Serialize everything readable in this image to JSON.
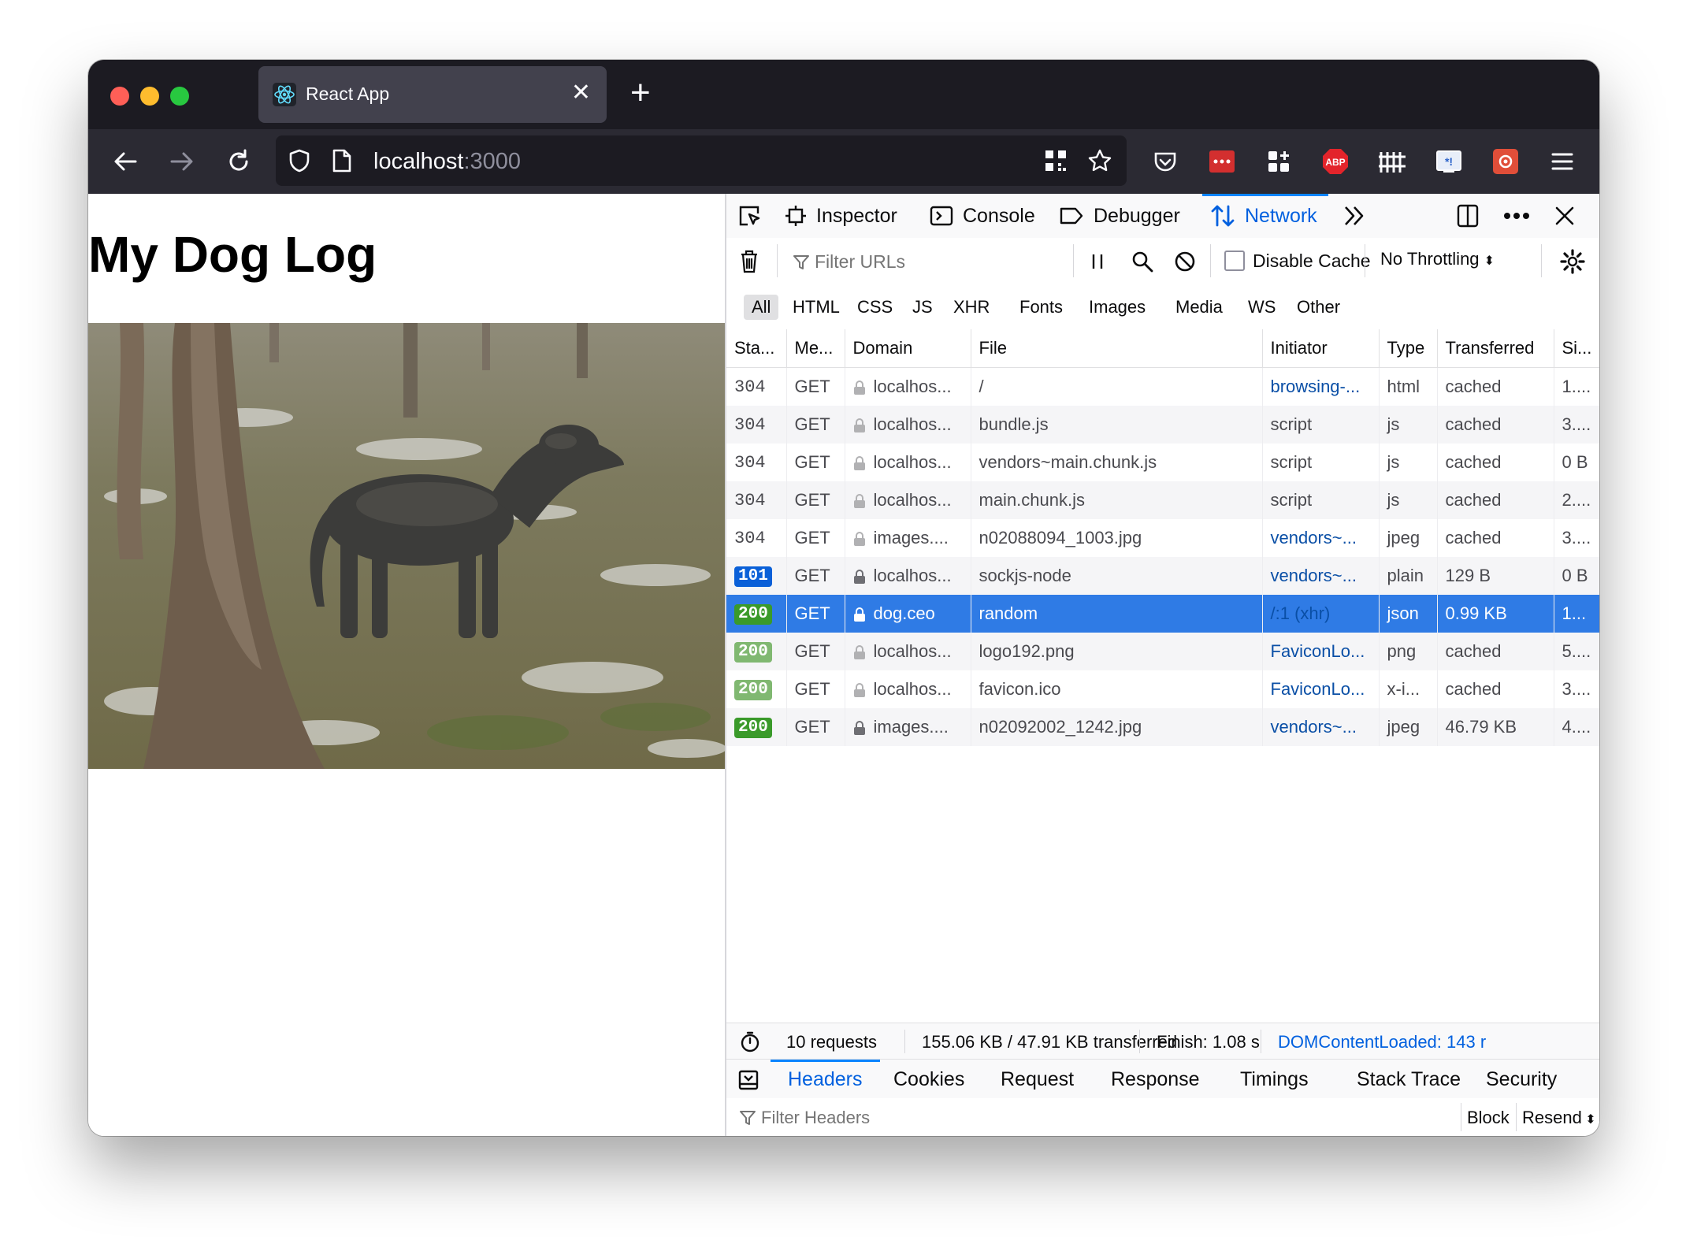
{
  "browser": {
    "tab_title": "React App",
    "url_host": "localhost",
    "url_port": ":3000"
  },
  "page": {
    "heading": "My Dog Log",
    "image_description_alt": "Dog photo"
  },
  "devtools": {
    "tabs": [
      {
        "label": "Inspector",
        "icon": "inspector-icon"
      },
      {
        "label": "Console",
        "icon": "console-icon"
      },
      {
        "label": "Debugger",
        "icon": "debugger-icon"
      },
      {
        "label": "Network",
        "icon": "network-icon",
        "selected": true
      }
    ],
    "filter": {
      "placeholder": "Filter URLs",
      "disable_cache_label": "Disable Cache",
      "throttling": "No Throttling"
    },
    "type_filters": [
      "All",
      "HTML",
      "CSS",
      "JS",
      "XHR",
      "Fonts",
      "Images",
      "Media",
      "WS",
      "Other"
    ],
    "columns": [
      "Sta...",
      "Me...",
      "Domain",
      "File",
      "Initiator",
      "Type",
      "Transferred",
      "Si..."
    ],
    "requests": [
      {
        "status": "304",
        "method": "GET",
        "domain": "localhos...",
        "file": "/",
        "initiator": "browsing-...",
        "initiator_link": true,
        "type": "html",
        "transferred": "cached",
        "size": "1...."
      },
      {
        "status": "304",
        "method": "GET",
        "domain": "localhos...",
        "file": "bundle.js",
        "initiator": "script",
        "initiator_link": false,
        "type": "js",
        "transferred": "cached",
        "size": "3...."
      },
      {
        "status": "304",
        "method": "GET",
        "domain": "localhos...",
        "file": "vendors~main.chunk.js",
        "initiator": "script",
        "initiator_link": false,
        "type": "js",
        "transferred": "cached",
        "size": "0 B"
      },
      {
        "status": "304",
        "method": "GET",
        "domain": "localhos...",
        "file": "main.chunk.js",
        "initiator": "script",
        "initiator_link": false,
        "type": "js",
        "transferred": "cached",
        "size": "2...."
      },
      {
        "status": "304",
        "method": "GET",
        "domain": "images....",
        "file": "n02088094_1003.jpg",
        "initiator": "vendors~...",
        "initiator_link": true,
        "type": "jpeg",
        "transferred": "cached",
        "size": "3...."
      },
      {
        "status": "101",
        "method": "GET",
        "domain": "localhos...",
        "file": "sockjs-node",
        "initiator": "vendors~...",
        "initiator_link": true,
        "type": "plain",
        "transferred": "129 B",
        "size": "0 B"
      },
      {
        "status": "200",
        "method": "GET",
        "domain": "dog.ceo",
        "file": "random",
        "initiator": "/:1 (xhr)",
        "initiator_link": true,
        "type": "json",
        "transferred": "0.99 KB",
        "size": "1...",
        "selected": true
      },
      {
        "status": "200",
        "method": "GET",
        "domain": "localhos...",
        "file": "logo192.png",
        "initiator": "FaviconLo...",
        "initiator_link": true,
        "type": "png",
        "transferred": "cached",
        "size": "5...."
      },
      {
        "status": "200",
        "method": "GET",
        "domain": "localhos...",
        "file": "favicon.ico",
        "initiator": "FaviconLo...",
        "initiator_link": true,
        "type": "x-i...",
        "transferred": "cached",
        "size": "3...."
      },
      {
        "status": "200",
        "method": "GET",
        "domain": "images....",
        "file": "n02092002_1242.jpg",
        "initiator": "vendors~...",
        "initiator_link": true,
        "type": "jpeg",
        "transferred": "46.79 KB",
        "size": "4...."
      }
    ],
    "summary": {
      "requests": "10 requests",
      "transferred": "155.06 KB / 47.91 KB transferred",
      "finish": "Finish: 1.08 s",
      "domcontentloaded": "DOMContentLoaded: 143 r"
    },
    "detail_tabs": [
      "Headers",
      "Cookies",
      "Request",
      "Response",
      "Timings",
      "Stack Trace",
      "Security"
    ],
    "header_filter_placeholder": "Filter Headers",
    "block_label": "Block",
    "resend_label": "Resend"
  },
  "colors": {
    "accent": "#0a84ff",
    "selected_row": "#2f7be5",
    "status_ok": "#3a9a2a",
    "status_info": "#0a60d8"
  }
}
